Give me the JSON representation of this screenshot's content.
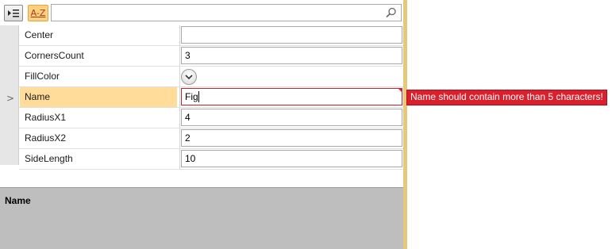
{
  "toolbar": {
    "categorize_icon": "categorize-list-icon",
    "sort_label": "A-Z",
    "search_placeholder": "",
    "search_icon": "search-icon"
  },
  "properties": [
    {
      "name": "Center",
      "value": ""
    },
    {
      "name": "CornersCount",
      "value": "3"
    },
    {
      "name": "FillColor",
      "value": ""
    },
    {
      "name": "Name",
      "value": "Fig"
    },
    {
      "name": "RadiusX1",
      "value": "4"
    },
    {
      "name": "RadiusX2",
      "value": "2"
    },
    {
      "name": "SideLength",
      "value": "10"
    }
  ],
  "selected_row_indicator": ">",
  "validation": {
    "message": "Name should contain more than 5 characters!"
  },
  "description": {
    "title": "Name"
  },
  "colors": {
    "accent_border": "#e8c878",
    "selected_name_bg": "#ffdc9a",
    "error": "#d9202c"
  }
}
